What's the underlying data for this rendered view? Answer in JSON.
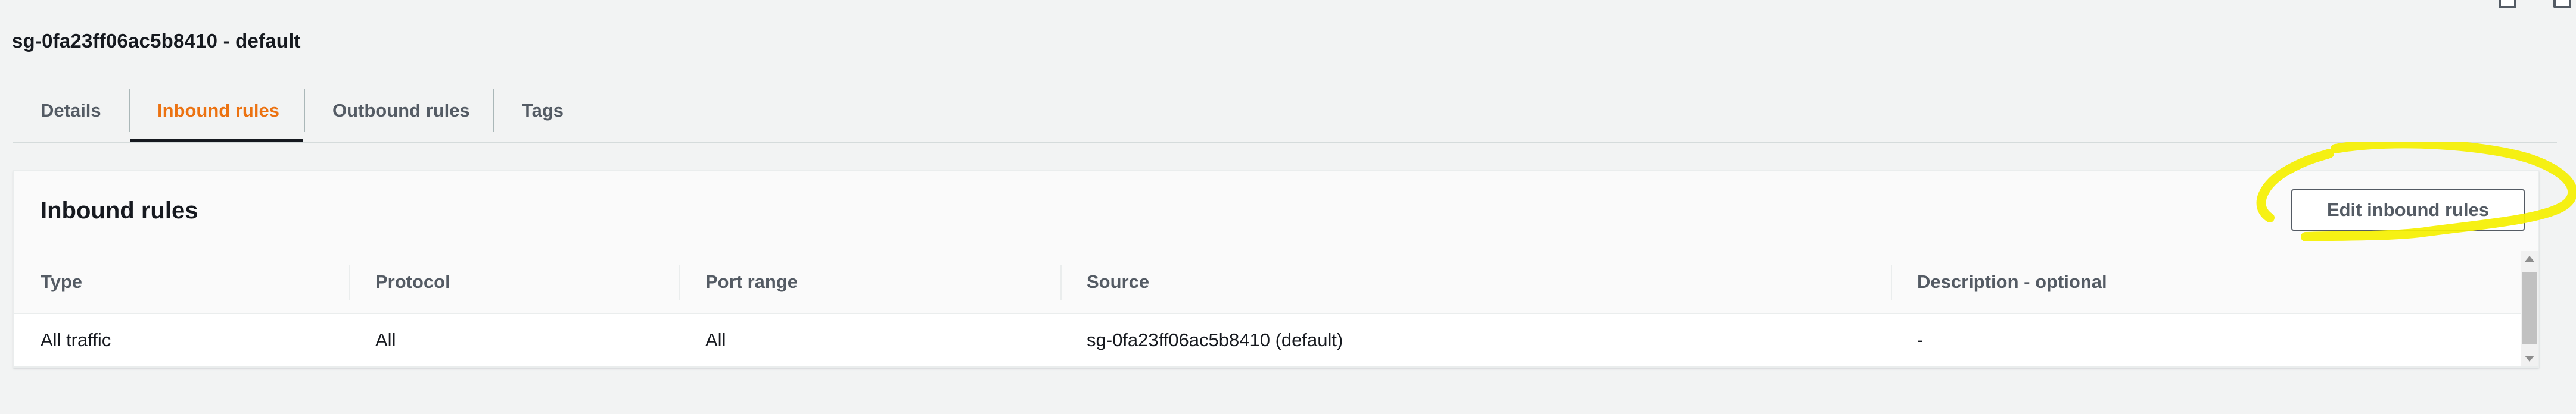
{
  "page": {
    "title": "sg-0fa23ff06ac5b8410 - default"
  },
  "tabs": [
    {
      "label": "Details"
    },
    {
      "label": "Inbound rules"
    },
    {
      "label": "Outbound rules"
    },
    {
      "label": "Tags"
    }
  ],
  "active_tab": "Inbound rules",
  "panel": {
    "title": "Inbound rules",
    "edit_label": "Edit inbound rules"
  },
  "table": {
    "columns": [
      "Type",
      "Protocol",
      "Port range",
      "Source",
      "Description - optional"
    ],
    "rows": [
      [
        "All traffic",
        "All",
        "All",
        "sg-0fa23ff06ac5b8410 (default)",
        "-"
      ]
    ]
  },
  "colors": {
    "active_tab": "#ec7211",
    "highlight_annotation": "#f5f000",
    "background": "#f2f3f3"
  },
  "icons": [
    "window-icon",
    "window-icon"
  ]
}
